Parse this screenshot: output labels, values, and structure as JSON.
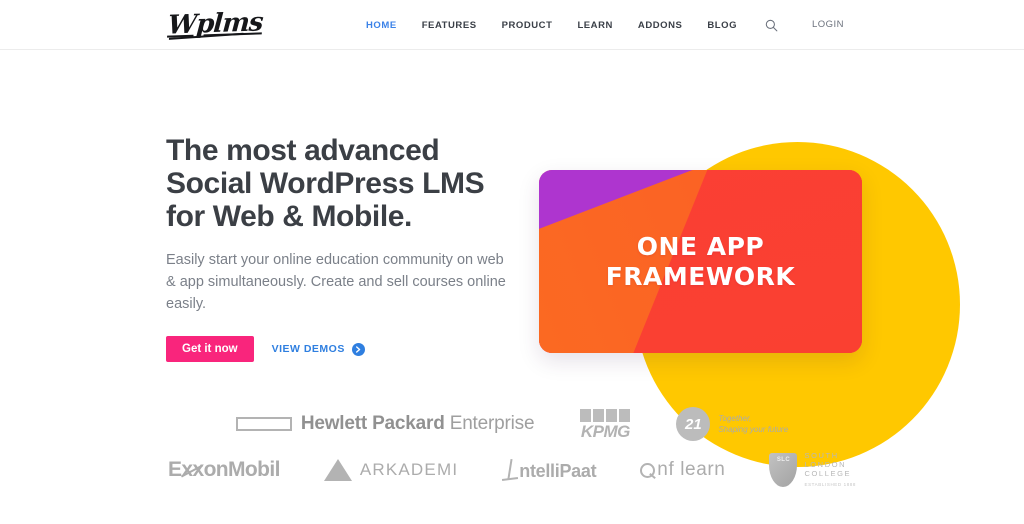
{
  "header": {
    "logo_text": "Wplms",
    "nav_items": [
      {
        "label": "HOME",
        "active": true
      },
      {
        "label": "FEATURES",
        "active": false
      },
      {
        "label": "PRODUCT",
        "active": false
      },
      {
        "label": "LEARN",
        "active": false
      },
      {
        "label": "ADDONS",
        "active": false
      },
      {
        "label": "BLOG",
        "active": false
      }
    ],
    "search_icon": "search-icon",
    "login_label": "LOGIN"
  },
  "hero": {
    "title": "The most advanced Social WordPress LMS for Web & Mobile.",
    "subtitle": "Easily start your online education community on web & app simultaneously. Create and sell courses online easily.",
    "primary_button": "Get it now",
    "secondary_button": "VIEW DEMOS",
    "secondary_icon": "arrow-right-circle-icon",
    "card_line1": "ONE APP",
    "card_line2": "FRAMEWORK"
  },
  "colors": {
    "accent_pink": "#f9257c",
    "accent_blue": "#2f7fe0",
    "blob_yellow": "#ffc800",
    "card_purple": "#ae35cf",
    "card_magenta": "#f62e63",
    "card_orange": "#fb6a22",
    "card_red": "#fa4330",
    "heading_gray": "#3b3f45",
    "body_gray": "#7b8089",
    "logo_gray": "#b4b7bb"
  },
  "clients": {
    "hpe": {
      "bold": "Hewlett Packard",
      "light": "Enterprise"
    },
    "kpmg": {
      "text": "KPMG"
    },
    "twentyone": {
      "mark": "21",
      "line1": "Together,",
      "line2": "Shaping your future"
    },
    "exxon": {
      "pre": "E",
      "xx": "xx",
      "post": "onMobil"
    },
    "arkademi": {
      "text": "ARKADEMI"
    },
    "intellipaat": {
      "text": "ntelliPaat"
    },
    "inflearn": {
      "text": "nf learn"
    },
    "southlondon": {
      "mark": "SLC",
      "line1": "SOUTH",
      "line2": "LONDON",
      "line3": "COLLEGE",
      "sub": "ESTABLISHED 1888"
    }
  }
}
